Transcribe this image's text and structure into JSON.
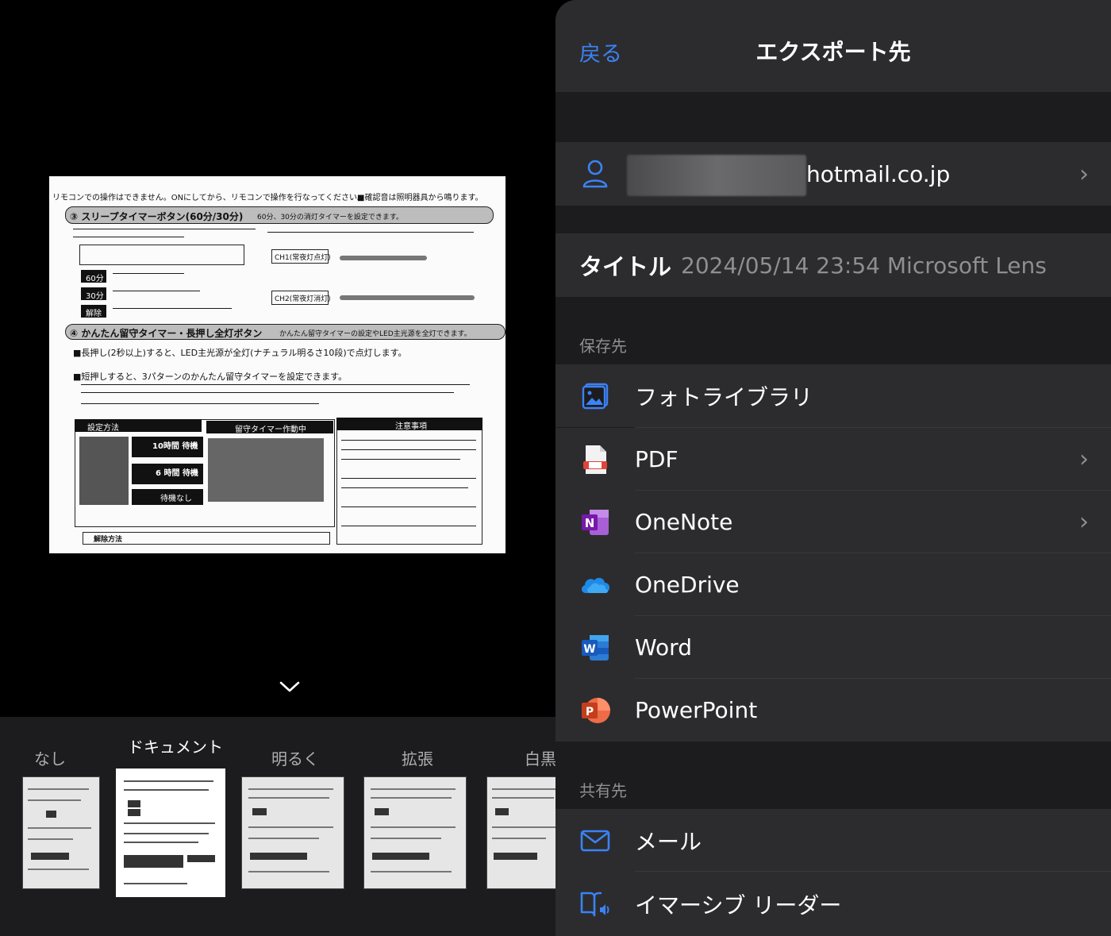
{
  "nav": {
    "back_label": "戻る",
    "title": "エクスポート先"
  },
  "account": {
    "email": "hotmail.co.jp"
  },
  "title_field": {
    "label": "タイトル",
    "value": "2024/05/14 23:54 Microsoft Lens"
  },
  "save_section": {
    "header": "保存先",
    "items": [
      {
        "label": "フォトライブラリ",
        "icon": "photo-library-icon",
        "chevron": false
      },
      {
        "label": "PDF",
        "icon": "pdf-icon",
        "chevron": true
      },
      {
        "label": "OneNote",
        "icon": "onenote-icon",
        "chevron": true
      },
      {
        "label": "OneDrive",
        "icon": "onedrive-icon",
        "chevron": false
      },
      {
        "label": "Word",
        "icon": "word-icon",
        "chevron": false
      },
      {
        "label": "PowerPoint",
        "icon": "powerpoint-icon",
        "chevron": false
      }
    ]
  },
  "share_section": {
    "header": "共有先",
    "items": [
      {
        "label": "メール",
        "icon": "mail-icon"
      },
      {
        "label": "イマーシブ リーダー",
        "icon": "immersive-reader-icon"
      }
    ]
  },
  "filters": {
    "selected": "ドキュメント",
    "items": [
      "なし",
      "ドキュメント",
      "明るく",
      "拡張",
      "白黒"
    ]
  },
  "document_preview": {
    "line1": "リモコンでの操作はできません。ONにしてから、リモコンで操作を行なってください。",
    "line1b": "■確認音は照明器具から鳴ります。",
    "heading3": "③ スリープタイマーボタン(60分/30分)",
    "heading3_note": "60分、30分の消灯タイマーを設定できます。",
    "heading4": "④ かんたん留守タイマー・長押し全灯ボタン",
    "heading4_note": "かんたん留守タイマーの設定やLED主光源を全灯できます。",
    "para1": "■長押し(2秒以上)すると、LED主光源が全灯(ナチュラル明るさ10段)で点灯します。",
    "para2": "■短押しすると、3パターンのかんたん留守タイマーを設定できます。",
    "b60": "60分",
    "b30": "30分",
    "bkai": "解除",
    "ch1": "CH1(常夜灯点灯)",
    "ch2": "CH2(常夜灯消灯)",
    "setting": "設定方法",
    "rusu": "留守タイマー作動中",
    "notes": "注意事項",
    "w10": "10時間 待機",
    "w6": "6 時間 待機",
    "w0": "待機なし",
    "release": "解除方法"
  },
  "colors": {
    "accent": "#3b82f6",
    "panel_bg": "#1c1c1e",
    "row_bg": "#2c2c2e"
  }
}
